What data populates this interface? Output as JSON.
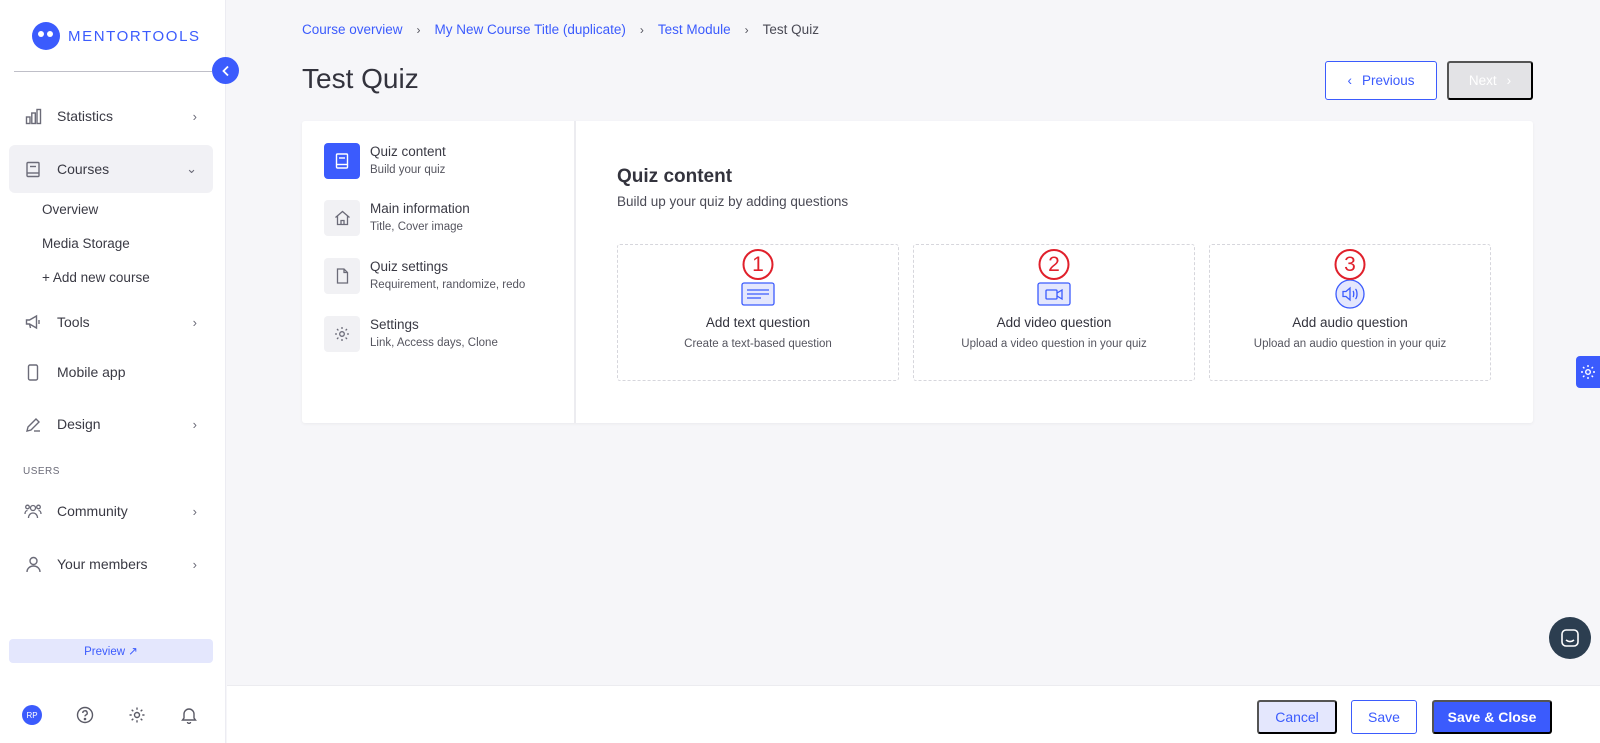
{
  "brand": {
    "name": "MENTORTOOLS",
    "color": "#3b5bfd"
  },
  "sidebar": {
    "items": [
      {
        "label": "Statistics",
        "icon": "bar-chart-icon"
      },
      {
        "label": "Courses",
        "icon": "book-icon",
        "active": true
      },
      {
        "label": "Tools",
        "icon": "megaphone-icon"
      },
      {
        "label": "Mobile app",
        "icon": "phone-icon"
      },
      {
        "label": "Design",
        "icon": "pencil-icon"
      },
      {
        "label": "Community",
        "icon": "community-icon"
      },
      {
        "label": "Your members",
        "icon": "user-icon"
      }
    ],
    "course_sub": [
      "Overview",
      "Media Storage",
      "+ Add new course"
    ],
    "users_section": "USERS",
    "preview_label": "Preview ↗",
    "avatar_initials": "RP"
  },
  "breadcrumb": [
    "Course overview",
    "My New Course Title (duplicate)",
    "Test Module",
    "Test Quiz"
  ],
  "page_title": "Test Quiz",
  "nav_buttons": {
    "previous": "Previous",
    "next": "Next"
  },
  "steps": [
    {
      "title": "Quiz content",
      "subtitle": "Build your quiz",
      "icon": "book-icon",
      "active": true
    },
    {
      "title": "Main information",
      "subtitle": "Title, Cover image",
      "icon": "home-icon"
    },
    {
      "title": "Quiz settings",
      "subtitle": "Requirement, randomize, redo",
      "icon": "document-icon"
    },
    {
      "title": "Settings",
      "subtitle": "Link, Access days, Clone",
      "icon": "gear-icon"
    }
  ],
  "content": {
    "title": "Quiz content",
    "subtitle": "Build up your quiz by adding questions",
    "cards": [
      {
        "badge": "1",
        "title": "Add text question",
        "subtitle": "Create a text-based question",
        "icon": "text-icon"
      },
      {
        "badge": "2",
        "title": "Add video question",
        "subtitle": "Upload a video question in your quiz",
        "icon": "video-icon"
      },
      {
        "badge": "3",
        "title": "Add audio question",
        "subtitle": "Upload an audio question in your quiz",
        "icon": "audio-icon"
      }
    ]
  },
  "footer": {
    "cancel": "Cancel",
    "save": "Save",
    "save_close": "Save & Close"
  }
}
